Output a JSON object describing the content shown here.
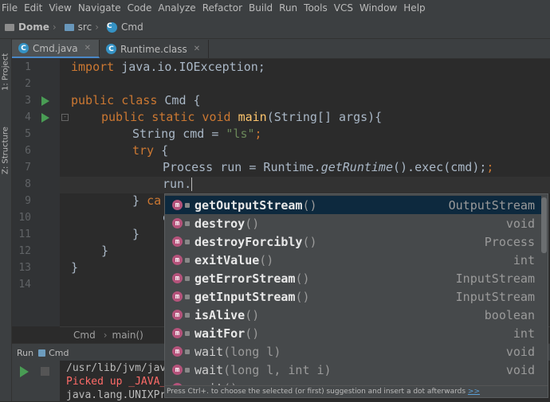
{
  "menu": [
    "File",
    "Edit",
    "View",
    "Navigate",
    "Code",
    "Analyze",
    "Refactor",
    "Build",
    "Run",
    "Tools",
    "VCS",
    "Window",
    "Help"
  ],
  "nav": {
    "project": "Dome",
    "folder": "src",
    "file": "Cmd"
  },
  "side_tabs": {
    "project": "1: Project",
    "structure": "Z: Structure"
  },
  "tabs": [
    {
      "label": "Cmd.java"
    },
    {
      "label": "Runtime.class"
    }
  ],
  "line_numbers": [
    "1",
    "2",
    "3",
    "4",
    "5",
    "6",
    "7",
    "8",
    "9",
    "10",
    "11",
    "12",
    "13",
    "14"
  ],
  "code": {
    "l1_kw": "import",
    "l1_rest": " java.io.IOException;",
    "l3_kw": "public class",
    "l3_rest": " Cmd {",
    "l4_kw": "public static void",
    "l4_fn": "main",
    "l4_rest": "(String[] args){",
    "l5_a": "String cmd = ",
    "l5_str": "\"ls\"",
    "l5_b": ";",
    "l6_kw": "try",
    "l6_rest": " {",
    "l7_a": "Process ",
    "l7_b": "run",
    "l7_c": " = Runtime.",
    "l7_it": "getRuntime",
    "l7_d": "().exec(cmd);",
    "l8": "run.",
    "l9_a": "} ",
    "l9_kw": "ca",
    "l10": "e",
    "l11": "}",
    "l12": "}",
    "l13": "}"
  },
  "breadcrumb": {
    "class": "Cmd",
    "method": "main()"
  },
  "run_panel": {
    "label": "Run",
    "config": "Cmd"
  },
  "console": {
    "line1": "/usr/lib/jvm/jav",
    "line2": "Picked up _JAVA_",
    "line3": "java.lang.UNIXPr"
  },
  "completion": [
    {
      "icon": "m",
      "name": "getOutputStream",
      "params": "()",
      "type": "OutputStream",
      "bold": true
    },
    {
      "icon": "m",
      "name": "destroy",
      "params": "()",
      "type": "void",
      "bold": true
    },
    {
      "icon": "m",
      "name": "destroyForcibly",
      "params": "()",
      "type": "Process",
      "bold": true
    },
    {
      "icon": "m",
      "name": "exitValue",
      "params": "()",
      "type": "int",
      "bold": true
    },
    {
      "icon": "m",
      "name": "getErrorStream",
      "params": "()",
      "type": "InputStream",
      "bold": true
    },
    {
      "icon": "m",
      "name": "getInputStream",
      "params": "()",
      "type": "InputStream",
      "bold": true
    },
    {
      "icon": "m",
      "name": "isAlive",
      "params": "()",
      "type": "boolean",
      "bold": true
    },
    {
      "icon": "m",
      "name": "waitFor",
      "params": "()",
      "type": "int",
      "bold": true
    },
    {
      "icon": "m",
      "name": "wait",
      "params": "(long l)",
      "type": "void",
      "bold": false
    },
    {
      "icon": "m",
      "name": "wait",
      "params": "(long l, int i)",
      "type": "void",
      "bold": false
    },
    {
      "icon": "m",
      "name": "wait",
      "params": "()",
      "type": "",
      "bold": false
    }
  ],
  "hint": {
    "text": "Press Ctrl+. to choose the selected (or first) suggestion and insert a dot afterwards",
    "link": ">>"
  }
}
